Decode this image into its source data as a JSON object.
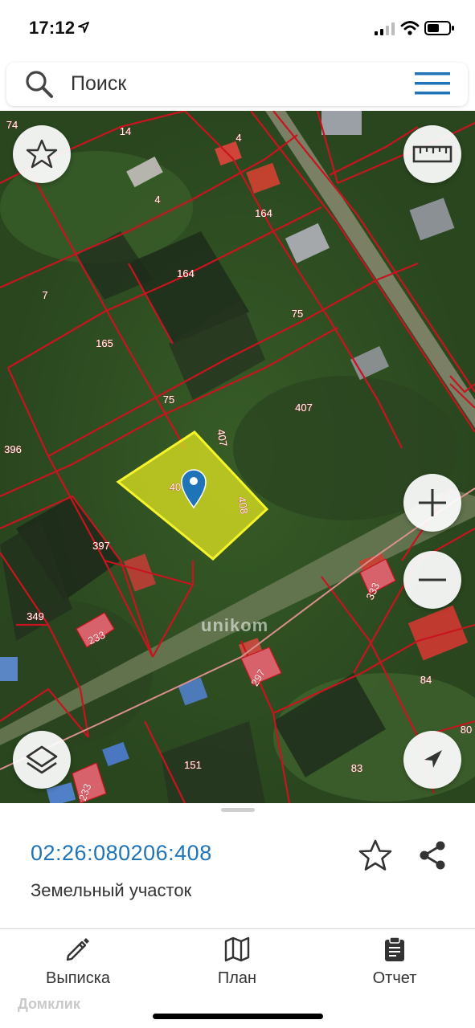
{
  "status_bar": {
    "time": "17:12"
  },
  "search": {
    "placeholder": "Поиск"
  },
  "map": {
    "parcel_labels": [
      "74",
      "14",
      "4",
      "4",
      "164",
      "164",
      "7",
      "75",
      "165",
      "75",
      "407",
      "407",
      "396",
      "40",
      "408",
      "397",
      "349",
      "233",
      "333",
      "297",
      "84",
      "151",
      "83",
      "80",
      "233"
    ],
    "selected_parcel_color": "#e8ea20",
    "boundary_color": "#c8141e",
    "watermark": "unikom"
  },
  "parcel": {
    "cadastral_number": "02:26:080206:408",
    "type": "Земельный участок"
  },
  "tabs": [
    {
      "label": "Выписка",
      "icon": "pencil-icon"
    },
    {
      "label": "План",
      "icon": "map-icon"
    },
    {
      "label": "Отчет",
      "icon": "clipboard-icon"
    }
  ],
  "branding": {
    "domclick": "Домклик"
  },
  "colors": {
    "accent": "#1f73b7",
    "boundary": "#c8141e",
    "selection": "#e8ea20"
  }
}
